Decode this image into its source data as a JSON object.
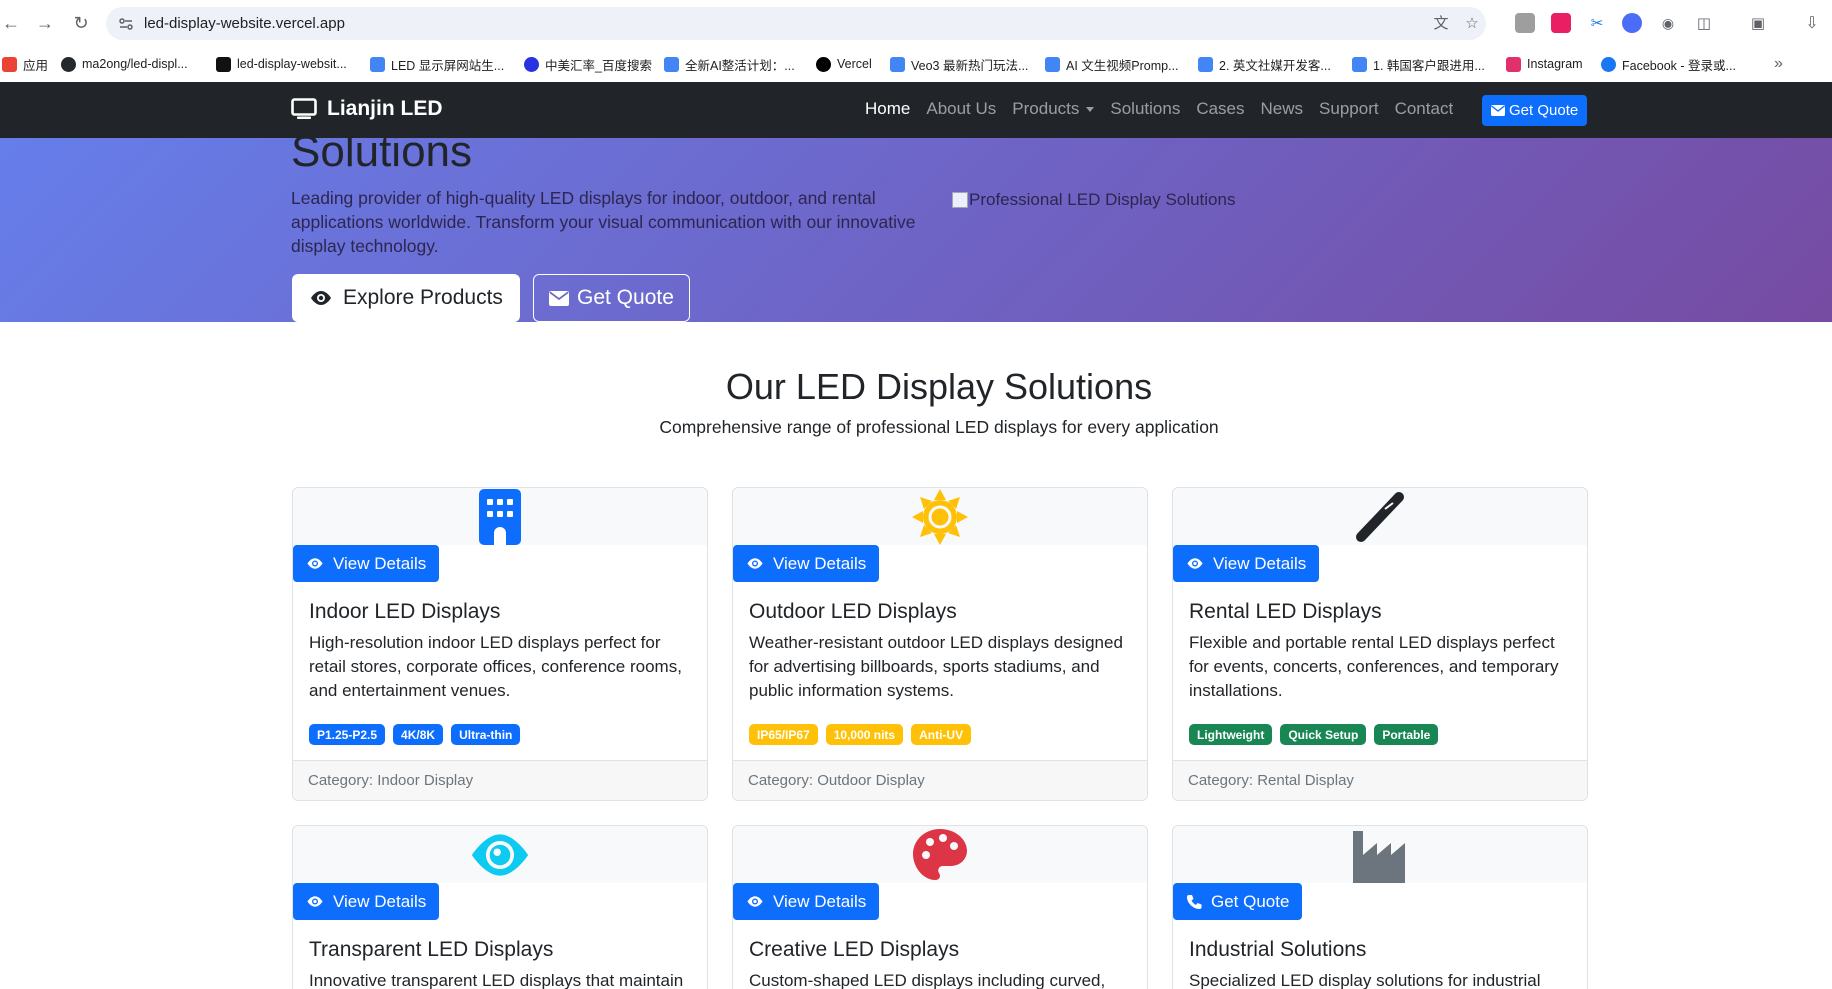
{
  "browser": {
    "url": "led-display-website.vercel.app",
    "bookmarks": [
      {
        "label": "应用",
        "color": "#ea4335"
      },
      {
        "label": "ma2ong/led-displ...",
        "color": "#24292e"
      },
      {
        "label": "led-display-websit...",
        "color": "#111"
      },
      {
        "label": "LED 显示屏网站生...",
        "color": "#4285f4"
      },
      {
        "label": "中美汇率_百度搜索",
        "color": "#2932e1"
      },
      {
        "label": "全新AI整活计划：...",
        "color": "#4285f4"
      },
      {
        "label": "Vercel",
        "color": "#000"
      },
      {
        "label": "Veo3 最新热门玩法...",
        "color": "#4285f4"
      },
      {
        "label": "AI 文生视频Promp...",
        "color": "#4285f4"
      },
      {
        "label": "2. 英文社媒开发客...",
        "color": "#4285f4"
      },
      {
        "label": "1. 韩国客户跟进用...",
        "color": "#4285f4"
      },
      {
        "label": "Instagram",
        "color": "#e1306c"
      },
      {
        "label": "Facebook - 登录或...",
        "color": "#1877f2"
      }
    ],
    "more_label": "»"
  },
  "navbar": {
    "brand": "Lianjin LED",
    "links": [
      {
        "label": "Home",
        "active": true
      },
      {
        "label": "About Us",
        "active": false
      },
      {
        "label": "Products",
        "active": false,
        "dropdown": true
      },
      {
        "label": "Solutions",
        "active": false
      },
      {
        "label": "Cases",
        "active": false
      },
      {
        "label": "News",
        "active": false
      },
      {
        "label": "Support",
        "active": false
      },
      {
        "label": "Contact",
        "active": false
      }
    ],
    "cta": "Get Quote"
  },
  "hero": {
    "title": "Solutions",
    "text": "Leading provider of high-quality LED displays for indoor, outdoor, and rental applications worldwide. Transform your visual communication with our innovative display technology.",
    "image_alt": "Professional LED Display Solutions",
    "btn_explore": "Explore Products",
    "btn_quote": "Get Quote"
  },
  "section": {
    "title": "Our LED Display Solutions",
    "subtitle": "Comprehensive range of professional LED displays for every application"
  },
  "cards": [
    {
      "icon": "building-icon",
      "icon_color": "#0d6efd",
      "button": "View Details",
      "button_icon": "eye-icon",
      "title": "Indoor LED Displays",
      "text": "High-resolution indoor LED displays perfect for retail stores, corporate offices, conference rooms, and entertainment venues.",
      "badges": [
        "P1.25-P2.5",
        "4K/8K",
        "Ultra-thin"
      ],
      "badge_style": "blue",
      "footer": "Category: Indoor Display"
    },
    {
      "icon": "sun-icon",
      "icon_color": "#ffc107",
      "button": "View Details",
      "button_icon": "eye-icon",
      "title": "Outdoor LED Displays",
      "text": "Weather-resistant outdoor LED displays designed for advertising billboards, sports stadiums, and public information systems.",
      "badges": [
        "IP65/IP67",
        "10,000 nits",
        "Anti-UV"
      ],
      "badge_style": "yellow",
      "footer": "Category: Outdoor Display"
    },
    {
      "icon": "tool-icon",
      "icon_color": "#212529",
      "button": "View Details",
      "button_icon": "eye-icon",
      "title": "Rental LED Displays",
      "text": "Flexible and portable rental LED displays perfect for events, concerts, conferences, and temporary installations.",
      "badges": [
        "Lightweight",
        "Quick Setup",
        "Portable"
      ],
      "badge_style": "green",
      "footer": "Category: Rental Display"
    },
    {
      "icon": "eye-icon",
      "icon_color": "#0dcaf0",
      "button": "View Details",
      "button_icon": "eye-icon",
      "title": "Transparent LED Displays",
      "text": "Innovative transparent LED displays that maintain"
    },
    {
      "icon": "palette-icon",
      "icon_color": "#dc3545",
      "button": "View Details",
      "button_icon": "eye-icon",
      "title": "Creative LED Displays",
      "text": "Custom-shaped LED displays including curved,"
    },
    {
      "icon": "industry-icon",
      "icon_color": "#6c757d",
      "button": "Get Quote",
      "button_icon": "phone-icon",
      "title": "Industrial Solutions",
      "text": "Specialized LED display solutions for industrial"
    }
  ]
}
